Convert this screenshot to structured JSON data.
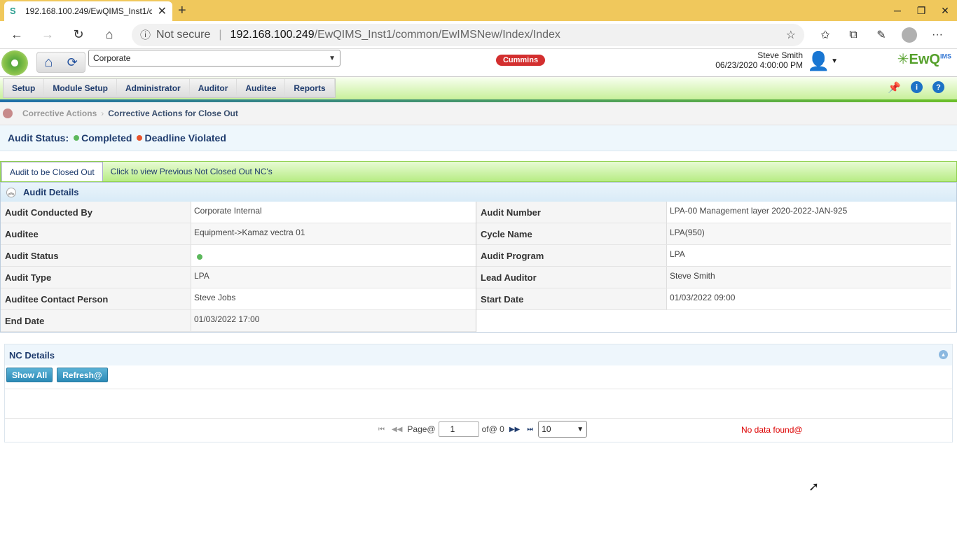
{
  "browser": {
    "tab_title": "192.168.100.249/EwQIMS_Inst1/c",
    "url_security": "Not secure",
    "url_host": "192.168.100.249",
    "url_path": "/EwQIMS_Inst1/common/EwIMSNew/Index/Index"
  },
  "header": {
    "location_select": "Corporate",
    "brand_logo_text": "Cummins",
    "user_name": "Steve Smith",
    "datetime": "06/23/2020 4:00:00 PM",
    "product_logo": "EwQ",
    "product_logo_sup": "IMS"
  },
  "menu": {
    "items": [
      "Setup",
      "Module Setup",
      "Administrator",
      "Auditor",
      "Auditee",
      "Reports"
    ]
  },
  "breadcrumb": {
    "parent": "Corrective Actions",
    "current": "Corrective Actions for Close Out"
  },
  "audit_status_bar": {
    "label": "Audit Status:",
    "completed": "Completed",
    "deadline": "Deadline Violated",
    "colors": {
      "completed": "#5cb85c",
      "deadline": "#e8532b"
    }
  },
  "tabs": [
    "Audit to be Closed Out",
    "Click to view Previous Not Closed Out NC's"
  ],
  "audit_details": {
    "title": "Audit Details",
    "left": [
      {
        "label": "Audit Conducted By",
        "value": "Corporate Internal"
      },
      {
        "label": "Auditee",
        "value": "Equipment->Kamaz vectra 01"
      },
      {
        "label": "Audit Status",
        "value": ""
      },
      {
        "label": "Audit Type",
        "value": "LPA"
      },
      {
        "label": "Auditee Contact Person",
        "value": "Steve Jobs"
      },
      {
        "label": "End Date",
        "value": "01/03/2022 17:00"
      }
    ],
    "right": [
      {
        "label": "Audit Number",
        "value": "LPA-00 Management layer 2020-2022-JAN-925"
      },
      {
        "label": "Cycle Name",
        "value": "LPA(950)"
      },
      {
        "label": "Audit Program",
        "value": "LPA"
      },
      {
        "label": "Lead Auditor",
        "value": "Steve Smith"
      },
      {
        "label": "Start Date",
        "value": "01/03/2022 09:00"
      }
    ]
  },
  "nc_details": {
    "title": "NC Details",
    "show_all": "Show All",
    "refresh": "Refresh@",
    "pager": {
      "page_label": "Page@",
      "page_value": "1",
      "of_label": "of@ 0",
      "page_size": "10",
      "no_data": "No data found@"
    }
  }
}
